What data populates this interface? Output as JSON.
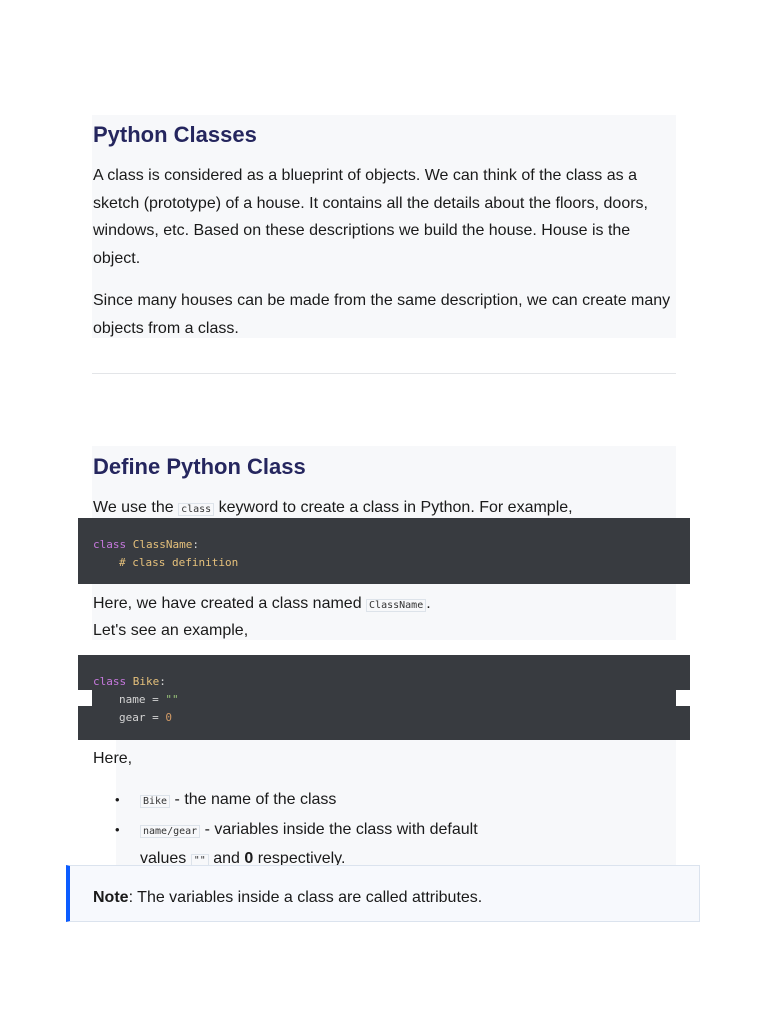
{
  "section1": {
    "title": "Python Classes",
    "para1": "A class is considered as a blueprint of objects. We can think of the class as a sketch (prototype) of a house. It contains all the details about the floors, doors, windows, etc. Based on these descriptions we build the house. House is the object.",
    "para2": "Since many houses can be made from the same description, we can create many objects from a class."
  },
  "section2": {
    "title": "Define Python Class",
    "intro_pre": "We use the ",
    "intro_code": "class",
    "intro_post": " keyword to create a class in Python. For example,",
    "code1": {
      "kw": "class",
      "name": "ClassName",
      "colon": ":",
      "comment": "# class definition"
    },
    "after_pre": "Here, we have created a class named ",
    "after_code": "ClassName",
    "after_post": ".",
    "example": "Let's see an example,",
    "code2": {
      "kw": "class",
      "name": "Bike",
      "colon": ":",
      "l2a": "name = ",
      "l2b": "\"\"",
      "l3a": "gear = ",
      "l3b": "0"
    },
    "here": "Here,",
    "bullets": [
      {
        "code": "Bike",
        "text": " - the name of the class"
      },
      {
        "code": "name/gear",
        "text": " - variables inside the class with default values ",
        "code2": "\"\"",
        "mid": " and ",
        "bold": "0",
        "end": " respectively."
      }
    ],
    "note": {
      "label": "Note",
      "text": ": The variables inside a class are called attributes."
    }
  }
}
